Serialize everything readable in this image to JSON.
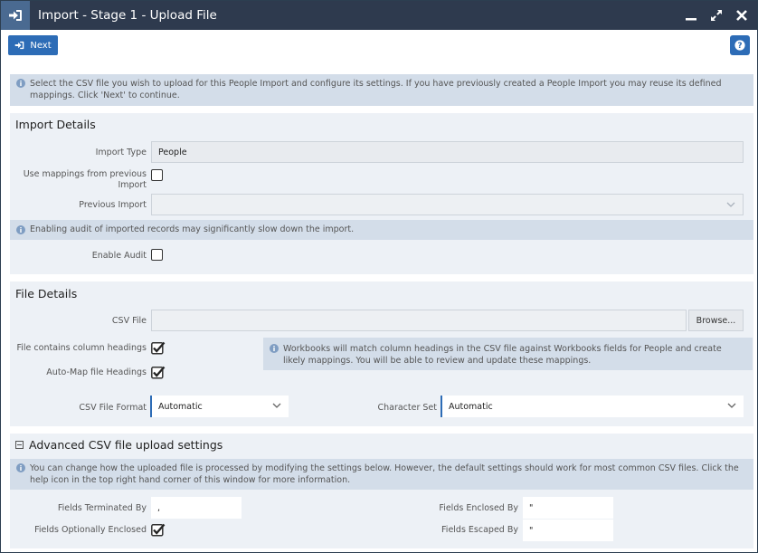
{
  "window": {
    "title": "Import - Stage 1 - Upload File"
  },
  "toolbar": {
    "next_label": "Next"
  },
  "intro": {
    "text": "Select the CSV file you wish to upload for this People Import and configure its settings. If you have previously created a People Import you may reuse its defined mappings. Click 'Next' to continue."
  },
  "import_details": {
    "title": "Import Details",
    "import_type_label": "Import Type",
    "import_type_value": "People",
    "use_mappings_label": "Use mappings from previous Import",
    "use_mappings_checked": false,
    "previous_import_label": "Previous Import",
    "previous_import_value": "",
    "audit_info": "Enabling audit of imported records may significantly slow down the import.",
    "enable_audit_label": "Enable Audit",
    "enable_audit_checked": false
  },
  "file_details": {
    "title": "File Details",
    "csv_file_label": "CSV File",
    "csv_file_value": "",
    "browse_label": "Browse...",
    "headings_label": "File contains column headings",
    "headings_checked": true,
    "automap_label": "Auto-Map file Headings",
    "automap_checked": true,
    "headings_info": "Workbooks will match column headings in the CSV file against Workbooks fields for People and create likely mappings. You will be able to review and update these mappings.",
    "format_label": "CSV File Format",
    "format_value": "Automatic",
    "charset_label": "Character Set",
    "charset_value": "Automatic"
  },
  "advanced": {
    "title": "Advanced CSV file upload settings",
    "info": "You can change how the uploaded file is processed by modifying the settings below. However, the default settings should work for most common CSV files. Click the help icon in the top right hand corner of this window for more information.",
    "terminated_label": "Fields Terminated By",
    "terminated_value": ",",
    "enclosed_label": "Fields Enclosed By",
    "enclosed_value": "\"",
    "optionally_label": "Fields Optionally Enclosed",
    "optionally_checked": true,
    "escaped_label": "Fields Escaped By",
    "escaped_value": "\""
  },
  "colors": {
    "titlebar": "#2e3a4e",
    "accent": "#2d6cb6",
    "info_bg": "#d3dde9",
    "panel_bg": "#edf1f6"
  }
}
